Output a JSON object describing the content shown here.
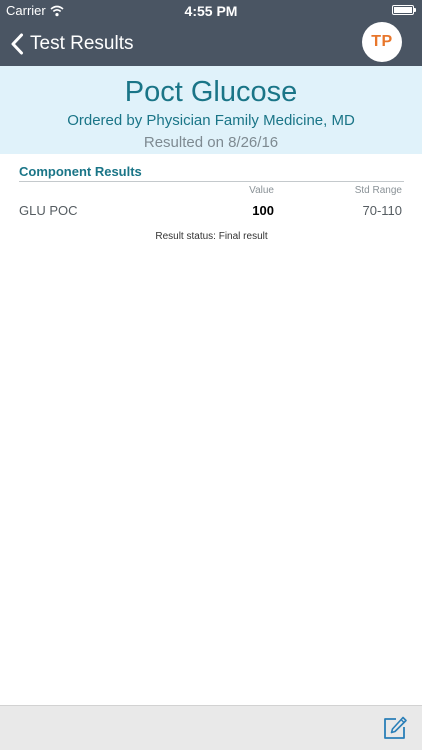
{
  "status_bar": {
    "carrier": "Carrier",
    "time": "4:55 PM"
  },
  "nav": {
    "back_label": "Test Results",
    "avatar_initials": "TP"
  },
  "header": {
    "title": "Poct Glucose",
    "ordered_by": "Ordered by Physician Family Medicine, MD",
    "resulted_on": "Resulted on 8/26/16"
  },
  "component_results": {
    "section_title": "Component Results",
    "columns": {
      "value": "Value",
      "std_range": "Std Range"
    },
    "rows": [
      {
        "name": "GLU POC",
        "value": "100",
        "std_range": "70-110"
      }
    ],
    "result_status": "Result status: Final result"
  },
  "colors": {
    "nav_bg": "#4a5563",
    "header_bg": "#e0f2fa",
    "accent": "#1a7587",
    "avatar_text": "#e8762b",
    "compose_icon": "#2a7fb8"
  },
  "icons": {
    "back": "chevron-left-icon",
    "wifi": "wifi-icon",
    "battery": "battery-icon",
    "compose": "compose-icon"
  }
}
